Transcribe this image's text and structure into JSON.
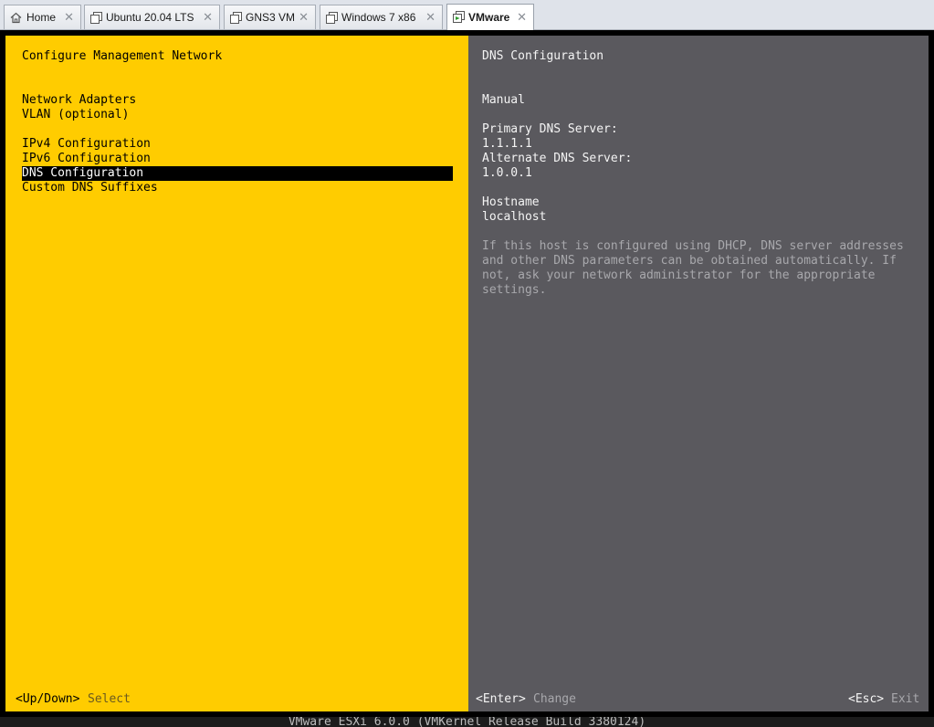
{
  "tabs": [
    {
      "label": "Home",
      "icon": "home-icon"
    },
    {
      "label": "Ubuntu 20.04 LTS",
      "icon": "vm-icon"
    },
    {
      "label": "GNS3 VM",
      "icon": "vm-icon"
    },
    {
      "label": "Windows 7 x86",
      "icon": "vm-icon"
    },
    {
      "label": "VMware",
      "icon": "vm-powered-on-icon",
      "active": true
    }
  ],
  "close_glyph": "✕",
  "left_panel": {
    "title": "Configure Management Network",
    "menu": [
      "Network Adapters",
      "VLAN (optional)",
      "IPv4 Configuration",
      "IPv6 Configuration",
      "DNS Configuration",
      "Custom DNS Suffixes"
    ],
    "selected_index": 4,
    "footer_key": "<Up/Down>",
    "footer_action": "Select"
  },
  "right_panel": {
    "title": "DNS Configuration",
    "mode": "Manual",
    "primary_dns_label": "Primary DNS Server:",
    "primary_dns_value": "1.1.1.1",
    "alternate_dns_label": "Alternate DNS Server:",
    "alternate_dns_value": "1.0.0.1",
    "hostname_label": "Hostname",
    "hostname_value": "localhost",
    "help_text": [
      "If this host is configured using DHCP, DNS server addresses",
      "and other DNS parameters can be obtained automatically. If",
      "not, ask your network administrator for the appropriate",
      "settings."
    ],
    "enter_key": "<Enter>",
    "enter_action": "Change",
    "esc_key": "<Esc>",
    "esc_action": "Exit"
  },
  "status_bar": "VMware ESXi 6.0.0 (VMKernel Release Build 3380124)",
  "colors": {
    "left_panel_bg": "#ffcc00",
    "right_panel_bg": "#5a595e",
    "selection_bg": "#000000"
  }
}
